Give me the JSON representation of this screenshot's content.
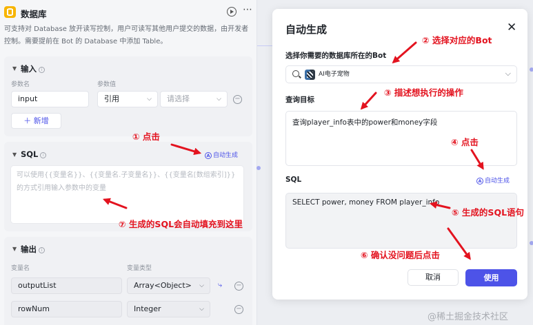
{
  "node": {
    "title": "数据库",
    "description": "可支持对 Database 放开读写控制，用户可读写其他用户提交的数据，由开发者控制。需要提前在 Bot 的 Database 中添加 Table。",
    "input": {
      "title": "输入",
      "col_name": "参数名",
      "col_value": "参数值",
      "param_name": "input",
      "value_type": "引用",
      "value_placeholder": "请选择",
      "add_label": "新增"
    },
    "sql": {
      "title": "SQL",
      "autogen_label": "自动生成",
      "placeholder": "可以使用{{变量名}}、{{变量名.子变量名}}、{{变量名[数组索引]}}的方式引用输入参数中的变量"
    },
    "output": {
      "title": "输出",
      "col_name": "变量名",
      "col_type": "变量类型",
      "rows": [
        {
          "name": "outputList",
          "type": "Array<Object>"
        },
        {
          "name": "rowNum",
          "type": "Integer"
        }
      ]
    }
  },
  "modal": {
    "title": "自动生成",
    "bot_label": "选择你需要的数据库所在的Bot",
    "bot_name": "AI电子宠物",
    "goal_label": "查询目标",
    "goal_text": "查询player_info表中的power和money字段",
    "sql_label": "SQL",
    "autogen_label": "自动生成",
    "sql_text": "SELECT power, money FROM player_info",
    "cancel_label": "取消",
    "use_label": "使用"
  },
  "annotations": {
    "a1": "① 点击",
    "a2": "② 选择对应的Bot",
    "a3": "③ 描述想执行的操作",
    "a4": "④ 点击",
    "a5": "⑤ 生成的SQL语句",
    "a6": "⑥ 确认没问题后点击",
    "a7": "⑦ 生成的SQL会自动填充到这里"
  },
  "watermark": "@稀土掘金技术社区",
  "colors": {
    "accent": "#4d53e8",
    "annotation": "#e3131f",
    "db_icon": "#f7b500"
  }
}
